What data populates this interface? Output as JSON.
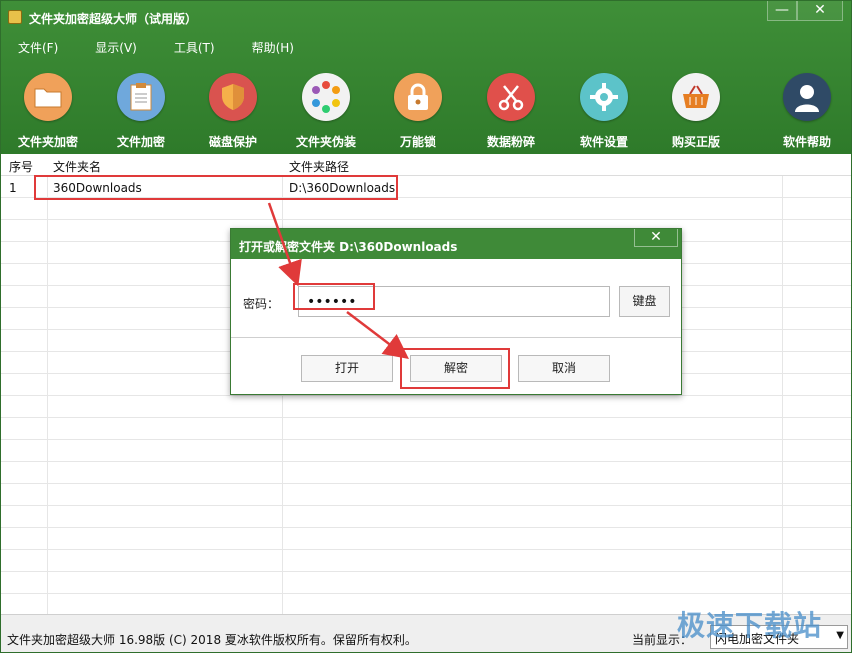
{
  "window": {
    "title": "文件夹加密超级大师（试用版）",
    "minimize_label": "—",
    "close_label": "✕"
  },
  "menu": [
    {
      "label": "文件(F)"
    },
    {
      "label": "显示(V)"
    },
    {
      "label": "工具(T)"
    },
    {
      "label": "帮助(H)"
    }
  ],
  "toolbar": [
    {
      "label": "文件夹加密",
      "icon": "folder-icon",
      "color": "#f0a15a"
    },
    {
      "label": "文件加密",
      "icon": "document-icon",
      "color": "#6fa8dc"
    },
    {
      "label": "磁盘保护",
      "icon": "shield-icon",
      "color": "#d9534f"
    },
    {
      "label": "文件夹伪装",
      "icon": "color-wheel-icon",
      "color": "#f2f2f2"
    },
    {
      "label": "万能锁",
      "icon": "padlock-icon",
      "color": "#f0a15a"
    },
    {
      "label": "数据粉碎",
      "icon": "scissors-icon",
      "color": "#e0504b"
    },
    {
      "label": "软件设置",
      "icon": "gear-icon",
      "color": "#5cc3c9"
    },
    {
      "label": "购买正版",
      "icon": "basket-icon",
      "color": "#f2f2f2"
    },
    {
      "label": "软件帮助",
      "icon": "user-help-icon",
      "color": "#2f4a66"
    }
  ],
  "table": {
    "columns": [
      "序号",
      "文件夹名",
      "文件夹路径"
    ],
    "rows": [
      {
        "index": "1",
        "name": "360Downloads",
        "path": "D:\\360Downloads"
      }
    ]
  },
  "dialog": {
    "title": "打开或解密文件夹 D:\\360Downloads",
    "close_label": "✕",
    "password_label": "密码：",
    "password_value": "••••••",
    "keyboard_button": "键盘",
    "open_button": "打开",
    "decrypt_button": "解密",
    "cancel_button": "取消"
  },
  "status_bar": {
    "text": "文件夹加密超级大师 16.98版 (C) 2018  夏冰软件版权所有。保留所有权利。",
    "view_label": "当前显示：",
    "view_select_value": "闪电加密文件夹"
  },
  "watermark": "极速下载站",
  "colors": {
    "header_green": "#3a8a34",
    "highlight_red": "#e03a3a"
  }
}
